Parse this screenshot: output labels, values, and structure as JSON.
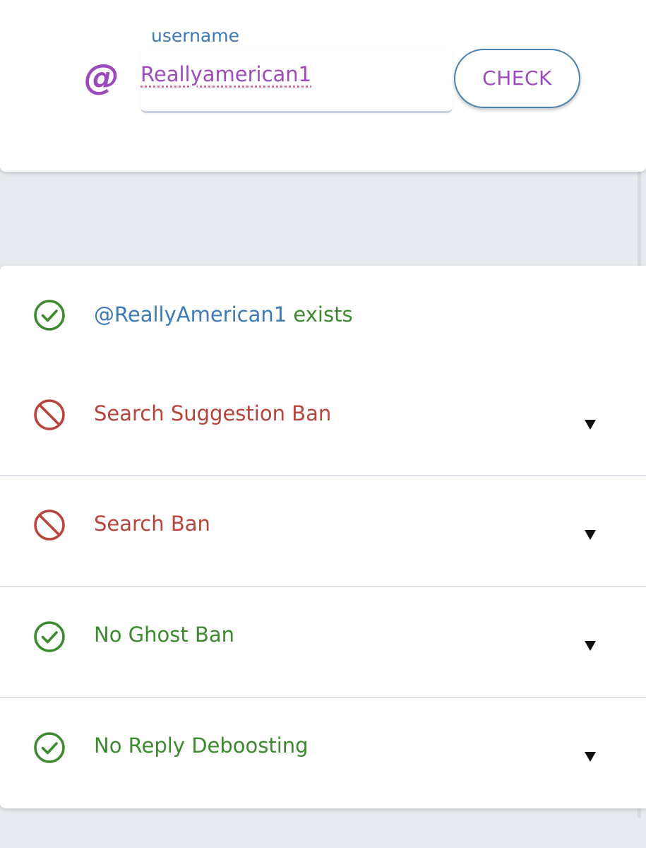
{
  "search": {
    "at_symbol": "@",
    "field_label": "username",
    "username_value": "Reallyamerican1",
    "check_label": "CHECK"
  },
  "results": {
    "exists": {
      "handle": "@ReallyAmerican1",
      "suffix": " exists",
      "status": "ok"
    },
    "items": [
      {
        "label": "Search Suggestion Ban",
        "status": "banned"
      },
      {
        "label": "Search Ban",
        "status": "banned"
      },
      {
        "label": "No Ghost Ban",
        "status": "ok"
      },
      {
        "label": "No Reply Deboosting",
        "status": "ok"
      }
    ]
  },
  "icons": {
    "ok": "check-circle-icon",
    "banned": "prohibited-icon",
    "expand": "caret-down-icon",
    "at": "at-sign-icon"
  },
  "colors": {
    "ok_green": "#3c8a2e",
    "ban_red": "#b8443c",
    "link_blue": "#3c7ab8",
    "accent_purple": "#9c4bbd",
    "background": "#e7eaee"
  }
}
